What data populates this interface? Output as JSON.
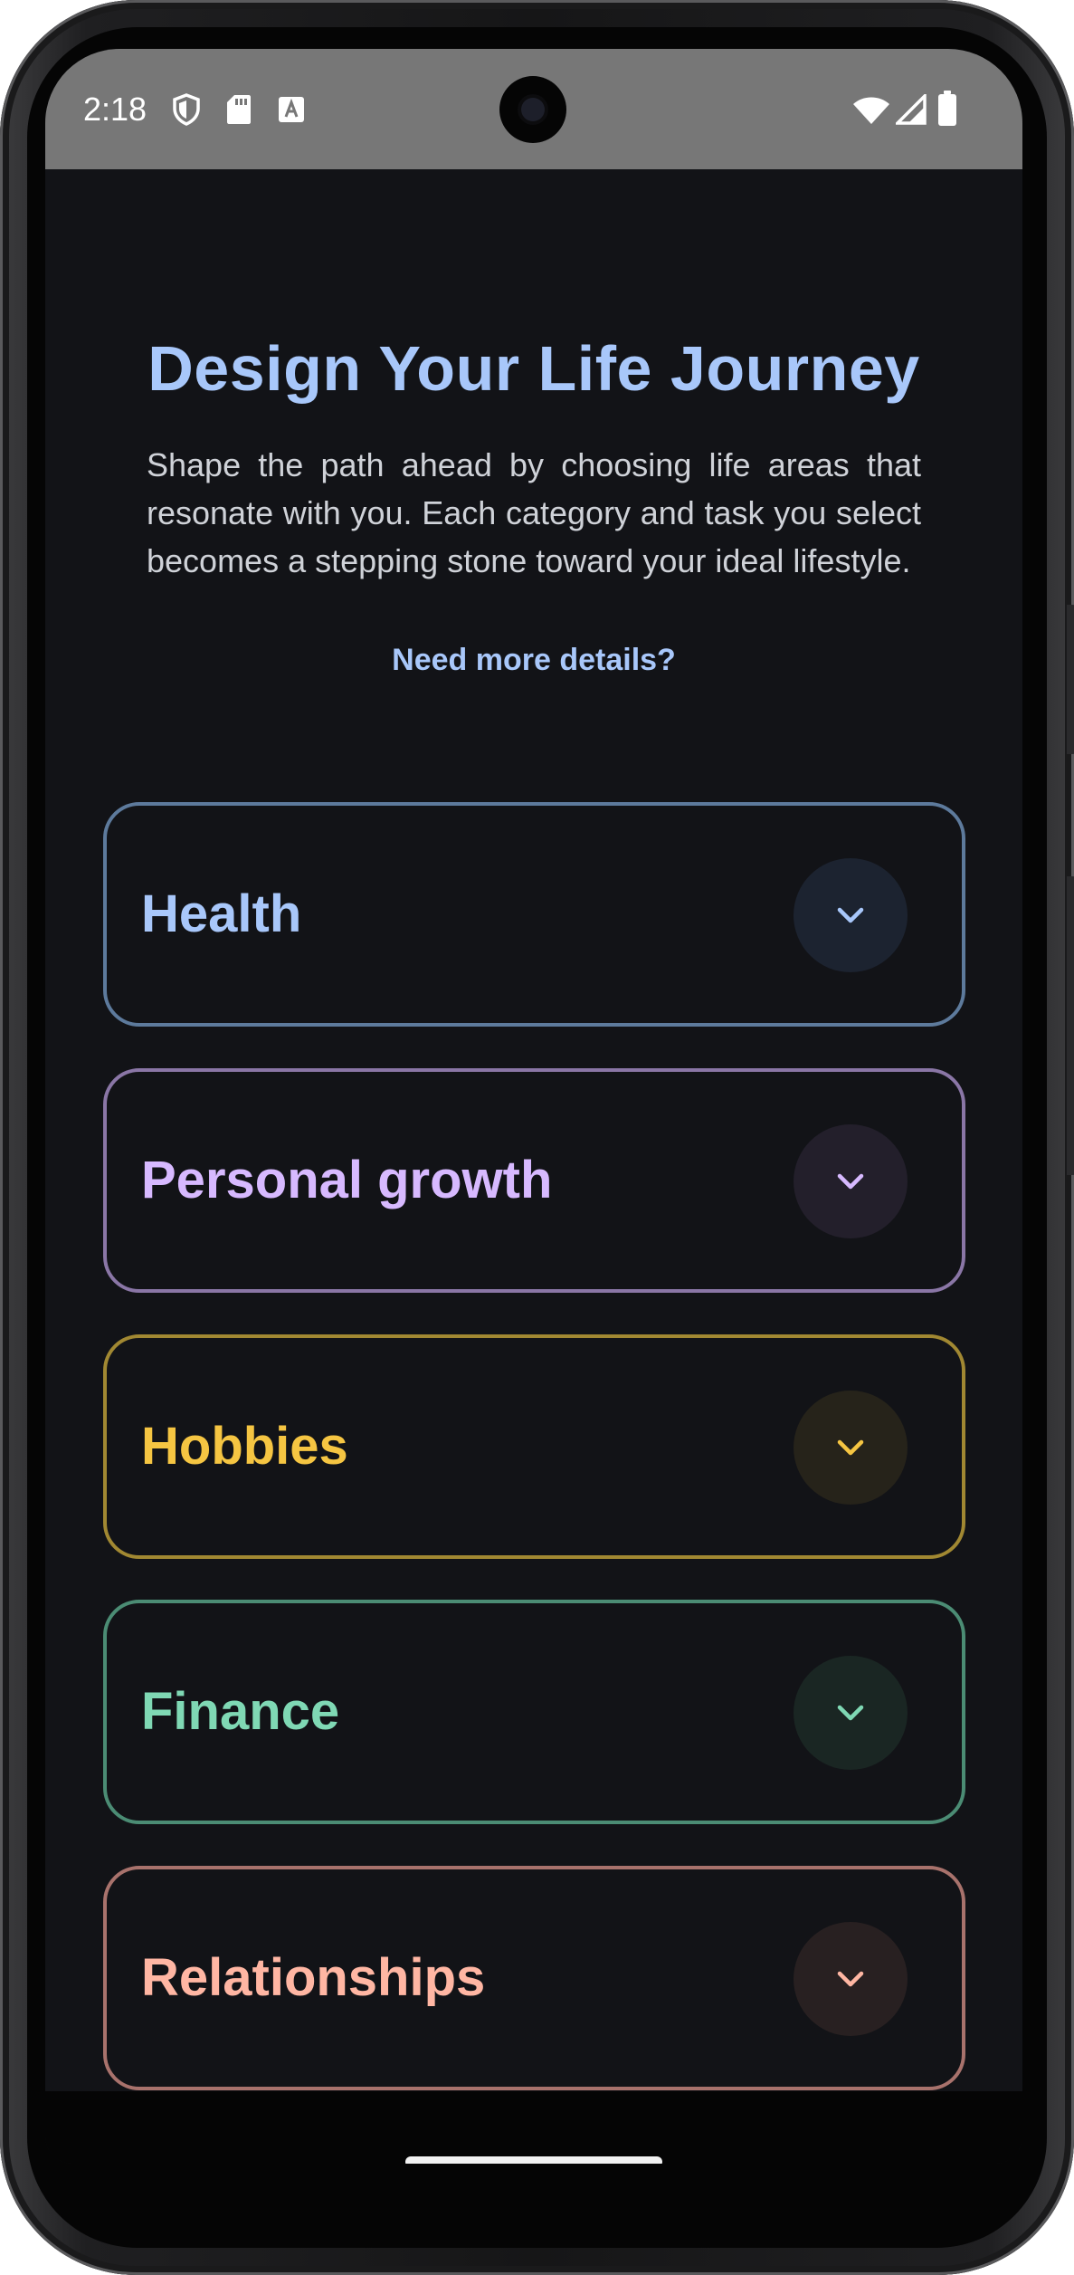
{
  "status_bar": {
    "time": "2:18",
    "icons": [
      "shield-icon",
      "sd-card-icon",
      "font-a-icon",
      "wifi-icon",
      "signal-icon",
      "battery-icon"
    ]
  },
  "header": {
    "title": "Design Your Life Journey",
    "description": "Shape the path ahead by choosing life areas that resonate with you. Each category and task you select becomes a stepping stone toward your ideal lifestyle.",
    "details_link": "Need more details?"
  },
  "categories": [
    {
      "label": "Health",
      "color": "#a8c7fa",
      "border": "#5d7a9c",
      "button_bg": "#1c2330"
    },
    {
      "label": "Personal growth",
      "color": "#d7b9ff",
      "border": "#8a76a6",
      "button_bg": "#231f2b"
    },
    {
      "label": "Hobbies",
      "color": "#f5c542",
      "border": "#a18832",
      "button_bg": "#26231a"
    },
    {
      "label": "Finance",
      "color": "#7fd8b4",
      "border": "#4b8c74",
      "button_bg": "#1a2623"
    },
    {
      "label": "Relationships",
      "color": "#ffb6a3",
      "border": "#a8726c",
      "button_bg": "#282021"
    },
    {
      "label": "",
      "color": "#7ccfcf",
      "border": "#4a8e8e",
      "button_bg": "#1a2626"
    }
  ]
}
